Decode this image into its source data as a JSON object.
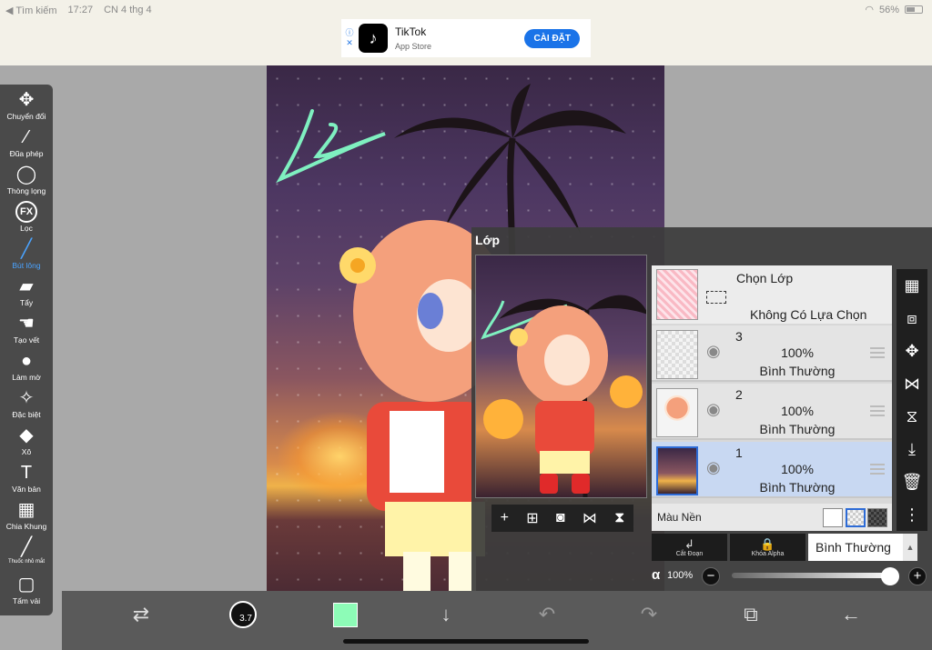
{
  "status": {
    "back": "◀ Tìm kiếm",
    "time": "17:27",
    "date": "CN 4 thg 4",
    "battery": "56%"
  },
  "ad": {
    "title": "TikTok",
    "subtitle": "App Store",
    "button": "CÀI ĐẶT"
  },
  "tools": [
    {
      "name": "move",
      "icon": "✥",
      "label": "Chuyển đổi"
    },
    {
      "name": "magic-wand",
      "icon": "⁄",
      "label": "Đũa phép"
    },
    {
      "name": "lasso",
      "icon": "◯",
      "label": "Thòng lọng"
    },
    {
      "name": "filter",
      "icon": "FX",
      "label": "Lọc"
    },
    {
      "name": "brush",
      "icon": "╱",
      "label": "Bút lông"
    },
    {
      "name": "eraser",
      "icon": "▰",
      "label": "Tẩy"
    },
    {
      "name": "smudge",
      "icon": "☚",
      "label": "Tạo vết"
    },
    {
      "name": "blur",
      "icon": "●",
      "label": "Làm mờ"
    },
    {
      "name": "special",
      "icon": "✧",
      "label": "Đặc biệt"
    },
    {
      "name": "fill",
      "icon": "◆",
      "label": "Xô"
    },
    {
      "name": "text",
      "icon": "T",
      "label": "Văn bản"
    },
    {
      "name": "divide",
      "icon": "▦",
      "label": "Chia Khung"
    },
    {
      "name": "eyedropper",
      "icon": "╱",
      "label": "Thuốc nhỏ mắt"
    },
    {
      "name": "canvas",
      "icon": "▢",
      "label": "Tấm vải"
    }
  ],
  "active_tool": "brush",
  "bottom": {
    "brush_size": "3.7",
    "color": "#8dfcb7"
  },
  "layers_panel": {
    "title": "Lớp",
    "selection": {
      "title": "Chọn Lớp",
      "subtitle": "Không Có Lựa Chọn"
    },
    "layers": [
      {
        "num": "3",
        "opacity": "100%",
        "mode": "Bình Thường",
        "selected": false
      },
      {
        "num": "2",
        "opacity": "100%",
        "mode": "Bình Thường",
        "selected": false
      },
      {
        "num": "1",
        "opacity": "100%",
        "mode": "Bình Thường",
        "selected": true
      }
    ],
    "background_label": "Màu Nền",
    "clip_label": "Cắt Đoạn",
    "alpha_lock_label": "Khóa Alpha",
    "blend_mode": "Bình Thường",
    "alpha_symbol": "α",
    "alpha_value": "100%"
  },
  "colors": {
    "toolbar": "#4a4a4a",
    "accent": "#4aa3ff",
    "selected_layer": "#c8d8f2",
    "brush_color": "#8dfcb7"
  }
}
